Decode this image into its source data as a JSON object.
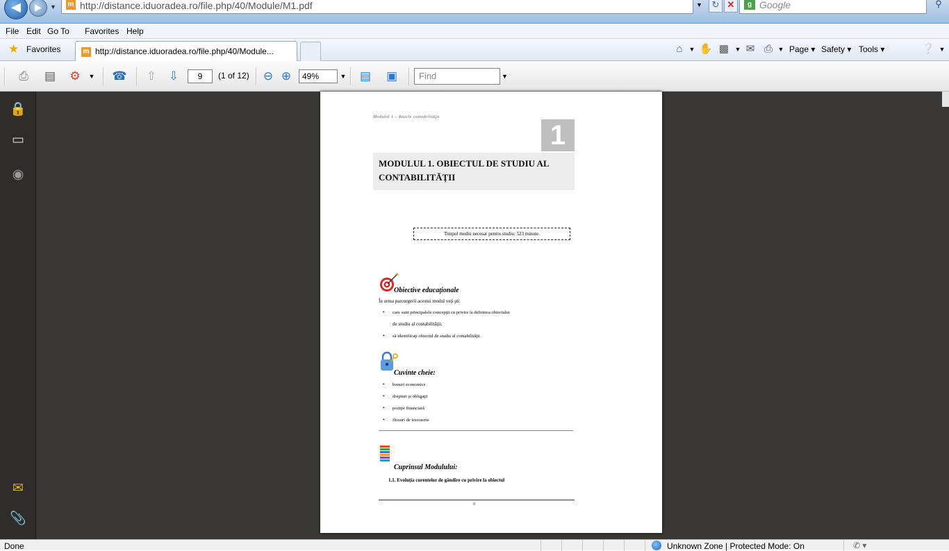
{
  "browser": {
    "url": "http://distance.iduoradea.ro/file.php/40/Module/M1.pdf",
    "search_placeholder": "Google",
    "favicon_letter": "m",
    "search_letter": "g"
  },
  "menu": [
    "File",
    "Edit",
    "Go To",
    "Favorites",
    "Help"
  ],
  "favorites_bar": {
    "favorites_label": "Favorites",
    "tab_title": "http://distance.iduoradea.ro/file.php/40/Module...",
    "commands": [
      "Page",
      "Safety",
      "Tools"
    ]
  },
  "pdf_toolbar": {
    "page_number": "9",
    "page_count": "(1 of 12)",
    "zoom": "49%",
    "find_placeholder": "Find"
  },
  "document": {
    "running_head": "Modulul 1 – Bazele contabilităţii",
    "chapter_number": "1",
    "title": "MODULUL 1. OBIECTUL DE STUDIU AL CONTABILITĂŢII",
    "time_note": "Timpul mediu necesar pentru studiu: 523 minute.",
    "objectives": {
      "heading": "Obiective educaţionale",
      "intro": "În urma parcurgerii acestui modul veţi şti:",
      "items": [
        "care sunt principalele concepţii cu privire la definirea obiectului",
        "de studiu al contabilităţii;",
        "să identificaţi obiectul de studiu al contabilităţii."
      ]
    },
    "keywords": {
      "heading": "Cuvinte cheie:",
      "items": [
        "bunuri economice",
        "drepturi şi obligaţii",
        "poziţie financiară",
        "fluxuri de trezorerie"
      ]
    },
    "contents": {
      "heading": "Cuprinsul Modulului:",
      "first_item": "1.1. Evoluţia curentelor de gândire cu privire la obiectul"
    },
    "page_number": "8"
  },
  "status_bar": {
    "left": "Done",
    "zone": "Unknown Zone | Protected Mode: On",
    "zoom_hint": "✆ ▾"
  },
  "colors": {
    "ie_blue": "#9fbfe3",
    "nav_pane": "#2f2d2b",
    "doc_background": "#3a3836"
  }
}
